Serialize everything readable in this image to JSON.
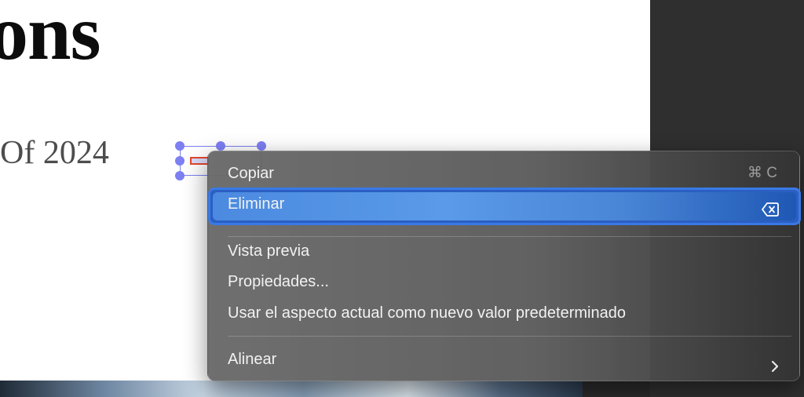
{
  "document": {
    "heading_fragment": "ons",
    "subheading_fragment": "Of 2024"
  },
  "context_menu": {
    "items": [
      {
        "label": "Copiar",
        "shortcut": "⌘ C"
      },
      {
        "label": "Eliminar",
        "shortcut_icon": "delete-backward-icon",
        "highlighted": true
      },
      {
        "label": "Vista previa"
      },
      {
        "label": "Propiedades..."
      },
      {
        "label": "Usar el aspecto actual como nuevo valor predeterminado"
      },
      {
        "label": "Alinear",
        "submenu_icon": "chevron-right-icon"
      }
    ]
  },
  "colors": {
    "highlight": "#4b8ae0",
    "highlight_border": "#3a79e6",
    "selection_handle": "#7d7ff3",
    "annotation_border": "#e2482d"
  }
}
